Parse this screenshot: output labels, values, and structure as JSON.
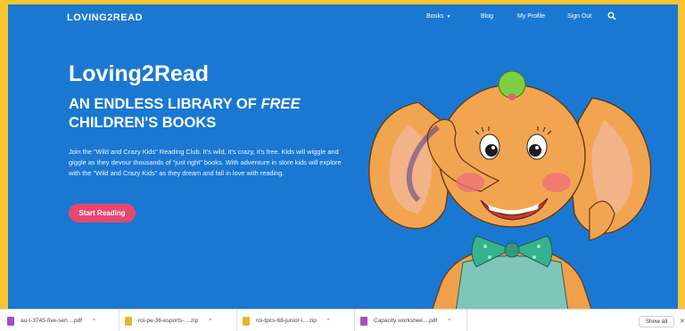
{
  "nav": {
    "logo": "LOVING2READ",
    "items": [
      {
        "label": "Books",
        "has_caret": true
      },
      {
        "label": "Blog"
      },
      {
        "label": "My Profile"
      },
      {
        "label": "Sign Out"
      }
    ],
    "search_icon": "search-icon"
  },
  "hero": {
    "title": "Loving2Read",
    "subtitle_pre": "AN ENDLESS LIBRARY OF ",
    "subtitle_em": "FREE",
    "subtitle_post": "CHILDREN'S BOOKS",
    "paragraph": "Join the \"Wild and Crazy Kids\" Reading Club. It's wild, it's crazy, it's free. Kids will wiggle and giggle as they devour thousands of \"just right\" books. With adventure in store kids will explore with the \"Wild and Crazy Kids\" as they dream and fall in love with reading.",
    "cta": "Start Reading"
  },
  "downloads": {
    "items": [
      {
        "name": "au-t-3745-five-sen....pdf",
        "type": "pdf"
      },
      {
        "name": "roi-pe-36-esports-....zip",
        "type": "zip"
      },
      {
        "name": "roi-tpcs-68-junior-i....zip",
        "type": "zip"
      },
      {
        "name": "Capacity workshee....pdf",
        "type": "pdf"
      }
    ],
    "show_all": "Show all",
    "close": "✕"
  },
  "colors": {
    "hero_bg": "#1a78d2",
    "cta_bg": "#e8486d",
    "frame_border": "#f7c531"
  }
}
